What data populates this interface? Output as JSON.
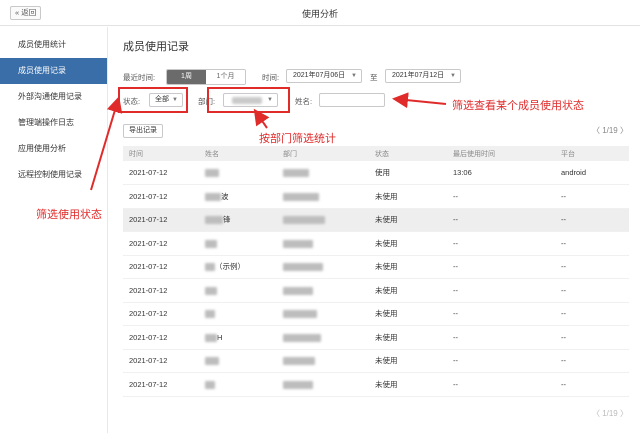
{
  "header": {
    "back_label": "« 返回",
    "title": "使用分析"
  },
  "sidebar": {
    "items": [
      {
        "label": "成员使用统计",
        "active": false
      },
      {
        "label": "成员使用记录",
        "active": true
      },
      {
        "label": "外部沟通使用记录",
        "active": false
      },
      {
        "label": "管理端操作日志",
        "active": false
      },
      {
        "label": "应用使用分析",
        "active": false
      },
      {
        "label": "远程控制使用记录",
        "active": false
      }
    ]
  },
  "main": {
    "title": "成员使用记录",
    "filters": {
      "recent_label": "最近时间:",
      "range_week": "1周",
      "range_month": "1个月",
      "time_label": "时间:",
      "date_from": "2021年07月06日",
      "to_label": "至",
      "date_to": "2021年07月12日",
      "status_label": "状态:",
      "status_value": "全部",
      "dept_label": "部门:",
      "name_label": "姓名:"
    },
    "export_label": "导出记录",
    "pager": "1/19",
    "table": {
      "columns": [
        "时间",
        "姓名",
        "部门",
        "状态",
        "最后使用时间",
        "平台"
      ],
      "rows": [
        {
          "date": "2021-07-12",
          "name_suffix": "",
          "status": "使用",
          "last": "13:06",
          "platform": "android"
        },
        {
          "date": "2021-07-12",
          "name_suffix": "波",
          "status": "未使用",
          "last": "--",
          "platform": "--"
        },
        {
          "date": "2021-07-12",
          "name_suffix": "锋",
          "status": "未使用",
          "last": "--",
          "platform": "--"
        },
        {
          "date": "2021-07-12",
          "name_suffix": "",
          "status": "未使用",
          "last": "--",
          "platform": "--"
        },
        {
          "date": "2021-07-12",
          "name_suffix": "（示例）",
          "status": "未使用",
          "last": "--",
          "platform": "--"
        },
        {
          "date": "2021-07-12",
          "name_suffix": "",
          "status": "未使用",
          "last": "--",
          "platform": "--"
        },
        {
          "date": "2021-07-12",
          "name_suffix": "",
          "status": "未使用",
          "last": "--",
          "platform": "--"
        },
        {
          "date": "2021-07-12",
          "name_suffix": "H",
          "status": "未使用",
          "last": "--",
          "platform": "--"
        },
        {
          "date": "2021-07-12",
          "name_suffix": "",
          "status": "未使用",
          "last": "--",
          "platform": "--"
        },
        {
          "date": "2021-07-12",
          "name_suffix": "",
          "status": "未使用",
          "last": "--",
          "platform": "--"
        }
      ]
    }
  },
  "annotations": {
    "status_note": "筛选使用状态",
    "dept_note": "按部门筛选统计",
    "member_note": "筛选查看某个成员使用状态",
    "color": "#e02b2b"
  }
}
